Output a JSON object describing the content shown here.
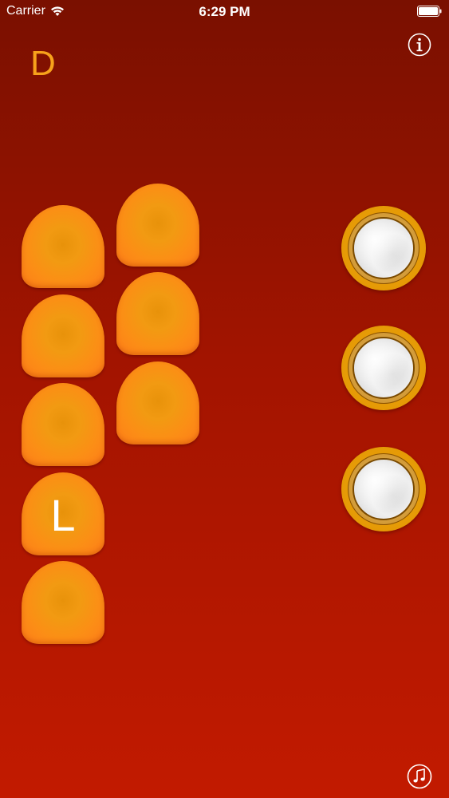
{
  "status_bar": {
    "carrier": "Carrier",
    "time": "6:29 PM"
  },
  "key_label": "D",
  "icons": {
    "wifi": "wifi-icon",
    "battery": "battery-icon",
    "info": "info-icon",
    "music": "music-note-icon"
  },
  "treble_buttons": {
    "row_left_labels": [
      "",
      "",
      "",
      "L",
      ""
    ],
    "row_right_labels": [
      "",
      "",
      ""
    ]
  },
  "bass_buttons": [
    "",
    "",
    ""
  ],
  "colors": {
    "background_top": "#7a1000",
    "background_bottom": "#c21a00",
    "button_orange": "#f29a12",
    "key_label": "#f7a21b",
    "pearl": "#efefef"
  }
}
